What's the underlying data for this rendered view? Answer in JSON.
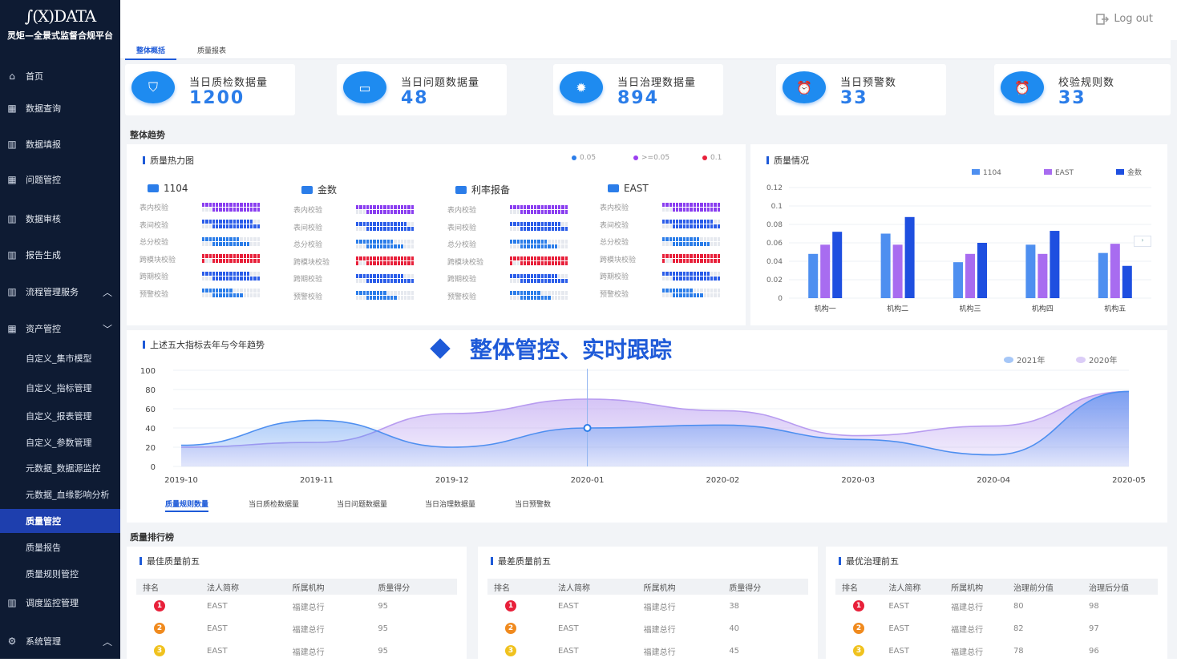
{
  "app": {
    "logo_mark": "∫(X)DATA",
    "platform_name": "灵矩—全景式监督合规平台",
    "logout": "Log out"
  },
  "sidebar": {
    "items": [
      {
        "label": "首页",
        "icon": "home-icon"
      },
      {
        "label": "数据查询",
        "icon": "grid-icon"
      },
      {
        "label": "数据填报",
        "icon": "bar-chart-icon"
      },
      {
        "label": "问题管控",
        "icon": "grid-icon"
      },
      {
        "label": "数据审核",
        "icon": "bar-chart-icon"
      },
      {
        "label": "报告生成",
        "icon": "bar-chart-icon"
      },
      {
        "label": "流程管理服务",
        "icon": "bar-chart-icon"
      },
      {
        "label": "资产管控",
        "icon": "grid-icon"
      },
      {
        "label": "调度监控管理",
        "icon": "bar-chart-icon"
      },
      {
        "label": "系统管理",
        "icon": "gear-icon"
      }
    ],
    "subitems": [
      "自定义_集市模型",
      "自定义_指标管理",
      "自定义_报表管理",
      "自定义_参数管理",
      "元数据_数据源监控",
      "元数据_血缘影响分析",
      "质量管控",
      "质量报告",
      "质量规则管控"
    ]
  },
  "tabs": [
    "整体概括",
    "质量报表"
  ],
  "stats": [
    {
      "label": "当日质检数据量",
      "value": "1200"
    },
    {
      "label": "当日问题数据量",
      "value": "48"
    },
    {
      "label": "当日治理数据量",
      "value": "894"
    },
    {
      "label": "当日预警数",
      "value": "33"
    },
    {
      "label": "校验规则数",
      "value": "33"
    }
  ],
  "sections": {
    "trend": "整体趋势",
    "ranking": "质量排行榜"
  },
  "heatmap": {
    "title": "质量热力图",
    "legend": [
      "0.05",
      ">=0.05",
      "0.1"
    ],
    "legend_colors": [
      "#2b7de9",
      "#9b3ff0",
      "#e8203a"
    ],
    "groups": [
      "1104",
      "金数",
      "利率报备",
      "EAST"
    ],
    "rows": [
      "表内校验",
      "表间校验",
      "总分校验",
      "跨模块校验",
      "跨期校验",
      "预警校验"
    ],
    "row_colors": [
      "#8a3ef0",
      "#2b5de9",
      "#2b7de9",
      "#e8203a",
      "#2b5de9",
      "#2b7de9"
    ],
    "row_fill": [
      0.85,
      0.75,
      0.55,
      0.9,
      0.7,
      0.45
    ]
  },
  "quality_chart": {
    "title": "质量情况",
    "chart_data": {
      "type": "bar",
      "categories": [
        "机构一",
        "机构二",
        "机构三",
        "机构四",
        "机构五"
      ],
      "series": [
        {
          "name": "1104",
          "values": [
            0.048,
            0.07,
            0.039,
            0.058,
            0.049
          ],
          "color": "#4e8ff0"
        },
        {
          "name": "EAST",
          "values": [
            0.058,
            0.058,
            0.048,
            0.048,
            0.059
          ],
          "color": "#a86cf0"
        },
        {
          "name": "金数",
          "values": [
            0.072,
            0.088,
            0.06,
            0.073,
            0.035
          ],
          "color": "#1e4fe0"
        }
      ],
      "ylim": [
        0,
        0.12
      ],
      "yticks": [
        "0",
        "0.02",
        "0.04",
        "0.06",
        "0.08",
        "0.1",
        "0.12"
      ]
    }
  },
  "trend_chart": {
    "title": "上述五大指标去年与今年趋势",
    "banner": "整体管控、实时跟踪",
    "chart_data": {
      "type": "area",
      "x": [
        "2019-10",
        "2019-11",
        "2019-12",
        "2020-01",
        "2020-02",
        "2020-03",
        "2020-04",
        "2020-05"
      ],
      "series": [
        {
          "name": "2021年",
          "values": [
            22,
            48,
            20,
            40,
            43,
            28,
            12,
            78
          ],
          "color": "#4e8ff0"
        },
        {
          "name": "2020年",
          "values": [
            20,
            25,
            55,
            70,
            58,
            32,
            42,
            78
          ],
          "color": "#b89cf0"
        }
      ],
      "ylim": [
        0,
        100
      ],
      "yticks": [
        "0",
        "20",
        "40",
        "60",
        "80",
        "100"
      ]
    },
    "subtabs": [
      "质量规则数量",
      "当日质检数据量",
      "当日问题数据量",
      "当日治理数据量",
      "当日预警数"
    ]
  },
  "rankings": [
    {
      "title": "最佳质量前五",
      "headers": [
        "排名",
        "法人简称",
        "所属机构",
        "质量得分"
      ],
      "rows": [
        [
          "1",
          "EAST",
          "福建总行",
          "95"
        ],
        [
          "2",
          "EAST",
          "福建总行",
          "95"
        ],
        [
          "3",
          "EAST",
          "福建总行",
          "95"
        ]
      ]
    },
    {
      "title": "最差质量前五",
      "headers": [
        "排名",
        "法人简称",
        "所属机构",
        "质量得分"
      ],
      "rows": [
        [
          "1",
          "EAST",
          "福建总行",
          "38"
        ],
        [
          "2",
          "EAST",
          "福建总行",
          "40"
        ],
        [
          "3",
          "EAST",
          "福建总行",
          "45"
        ]
      ]
    },
    {
      "title": "最优治理前五",
      "headers": [
        "排名",
        "法人简称",
        "所属机构",
        "治理前分值",
        "治理后分值"
      ],
      "rows": [
        [
          "1",
          "EAST",
          "福建总行",
          "80",
          "98"
        ],
        [
          "2",
          "EAST",
          "福建总行",
          "82",
          "97"
        ],
        [
          "3",
          "EAST",
          "福建总行",
          "78",
          "96"
        ]
      ]
    }
  ],
  "rank_colors": [
    "#e8203a",
    "#f08a1e",
    "#f0c21e"
  ]
}
